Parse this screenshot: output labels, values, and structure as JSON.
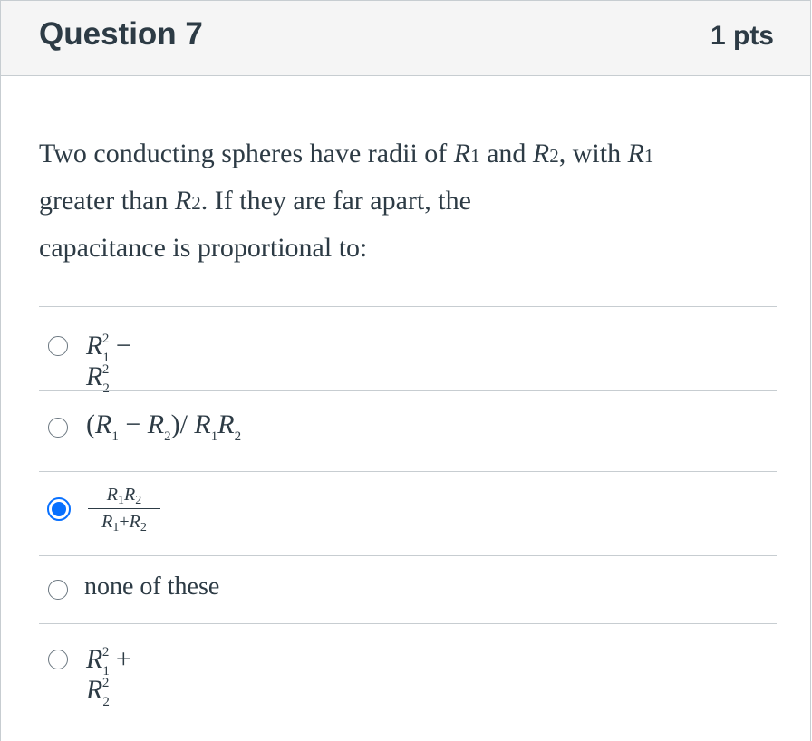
{
  "header": {
    "title": "Question 7",
    "points": "1 pts"
  },
  "question": {
    "text_part1": "Two conducting spheres have radii of ",
    "var_r": "R",
    "sub_1": "1",
    "sub_2": "2",
    "and": " and ",
    "text_part2": ", with ",
    "text_part3": "greater than ",
    "text_part4": ". If they are far apart, the",
    "text_part5": "capacitance is proportional to:"
  },
  "answers": [
    {
      "id": "a",
      "formula": "R1^2 - R2^2",
      "selected": false
    },
    {
      "id": "b",
      "formula": "(R1 - R2) / R1R2",
      "selected": false
    },
    {
      "id": "c",
      "formula": "R1R2 / (R1+R2)",
      "selected": true
    },
    {
      "id": "d",
      "label": "none of these",
      "selected": false
    },
    {
      "id": "e",
      "formula": "R1^2 + R2^2",
      "selected": false
    }
  ],
  "math_tokens": {
    "R": "R",
    "one": "1",
    "two": "2",
    "minus": "−",
    "plus": "+",
    "lparen": "(",
    "rparen": ")",
    "slash": "/"
  },
  "colors": {
    "text": "#2d3b45",
    "header_bg": "#f5f5f5",
    "border": "#c7cdd1",
    "selected": "#0770ff"
  }
}
